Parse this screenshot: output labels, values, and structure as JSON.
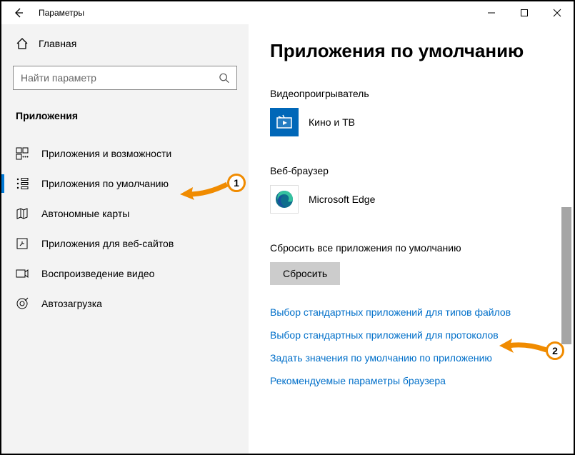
{
  "titlebar": {
    "title": "Параметры"
  },
  "sidebar": {
    "home_label": "Главная",
    "search_placeholder": "Найти параметр",
    "section_title": "Приложения",
    "items": [
      {
        "label": "Приложения и возможности"
      },
      {
        "label": "Приложения по умолчанию"
      },
      {
        "label": "Автономные карты"
      },
      {
        "label": "Приложения для веб-сайтов"
      },
      {
        "label": "Воспроизведение видео"
      },
      {
        "label": "Автозагрузка"
      }
    ]
  },
  "content": {
    "heading": "Приложения по умолчанию",
    "video_player": {
      "title": "Видеопроигрыватель",
      "app": "Кино и ТВ"
    },
    "web_browser": {
      "title": "Веб-браузер",
      "app": "Microsoft Edge"
    },
    "reset": {
      "title": "Сбросить все приложения по умолчанию",
      "button": "Сбросить"
    },
    "links": [
      "Выбор стандартных приложений для типов файлов",
      "Выбор стандартных приложений для протоколов",
      "Задать значения по умолчанию по приложению",
      "Рекомендуемые параметры браузера"
    ]
  },
  "annotations": {
    "a1": "1",
    "a2": "2"
  }
}
